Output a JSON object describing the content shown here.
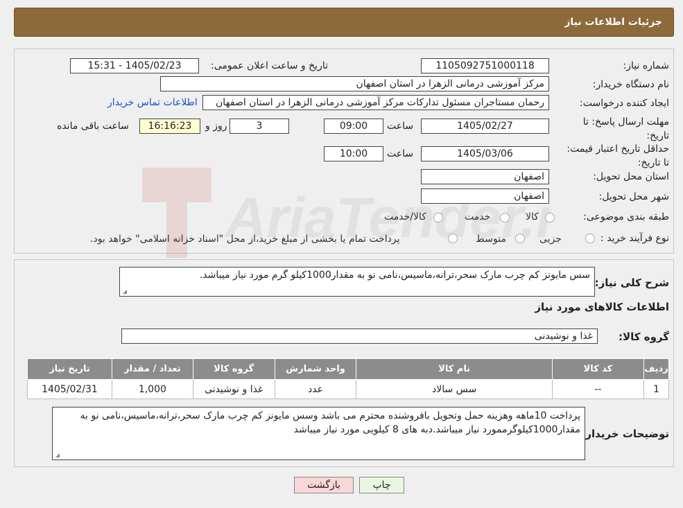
{
  "header": {
    "title": "جزئیات اطلاعات نیاز"
  },
  "need_number": {
    "label": "شماره نیاز:",
    "value": "1105092751000118"
  },
  "announce": {
    "label": "تاریخ و ساعت اعلان عمومی:",
    "value": "1405/02/23 - 15:31"
  },
  "buyer_org": {
    "label": "نام دستگاه خریدار:",
    "value": "مرکز آموزشی درمانی الزهرا در استان اصفهان"
  },
  "creator": {
    "label": "ایجاد کننده درخواست:",
    "value": "رحمان مستاجران مسئول تدارکات مرکز آموزشی درمانی الزهرا در استان اصفهان",
    "contact_link": "اطلاعات تماس خریدار"
  },
  "reply_deadline": {
    "label": "مهلت ارسال پاسخ: تا تاریخ:",
    "date": "1405/02/27",
    "time_label": "ساعت",
    "time": "09:00",
    "days": "3",
    "days_label": "روز و",
    "remaining": "16:16:23",
    "remaining_label": "ساعت باقی مانده"
  },
  "price_validity": {
    "label": "حداقل تاریخ اعتبار قیمت: تا تاریخ:",
    "date": "1405/03/06",
    "time_label": "ساعت",
    "time": "10:00"
  },
  "province": {
    "label": "استان محل تحویل:",
    "value": "اصفهان"
  },
  "city": {
    "label": "شهر محل تحویل:",
    "value": "اصفهان"
  },
  "category": {
    "label": "طبقه بندی موضوعی:",
    "options": [
      "کالا",
      "خدمت",
      "کالا/خدمت"
    ]
  },
  "purchase_type": {
    "label": "نوع فرآیند خرید :",
    "options": [
      "جزیی",
      "متوسط"
    ],
    "note": "پرداخت تمام یا بخشی از مبلغ خرید،از محل \"اسناد خزانه اسلامی\" خواهد بود."
  },
  "description": {
    "label": "شرح کلی نیاز:",
    "value": "سس مایونز کم چرب مارک سحر،ترانه،ماسیس،نامی نو به مقدار1000کیلو گرم مورد نیاز میباشد."
  },
  "goods_info": {
    "title": "اطلاعات کالاهای مورد نیاز"
  },
  "goods_group": {
    "label": "گروه کالا:",
    "value": "غذا و نوشیدنی"
  },
  "table": {
    "headers": [
      "ردیف",
      "کد کالا",
      "نام کالا",
      "واحد شمارش",
      "گروه کالا",
      "تعداد / مقدار",
      "تاریخ نیاز"
    ],
    "rows": [
      [
        "1",
        "--",
        "سس سالاد",
        "عدد",
        "غذا و نوشیدنی",
        "1,000",
        "1405/02/31"
      ]
    ]
  },
  "buyer_notes": {
    "label": "توضیحات خریدار:",
    "value": "پرداخت 10ماهه وهزینه حمل وتحویل بافروشنده محترم  می باشد وسس مایونز کم چرب مارک سحر،ترانه،ماسیس،نامی نو به مقدار1000کیلوگرممورد نیاز میباشد.دبه های 8 کیلویی مورد نیاز میباشد"
  },
  "buttons": {
    "print": "چاپ",
    "back": "بازگشت"
  },
  "watermark": {
    "text": "AriaTender.neT"
  },
  "colors": {
    "header_bg": "#8c6a3a",
    "table_header_bg": "#8c8c8c",
    "link": "#1a4fcf",
    "back_btn": "#f9d7d7",
    "print_btn": "#e9f7e2"
  }
}
